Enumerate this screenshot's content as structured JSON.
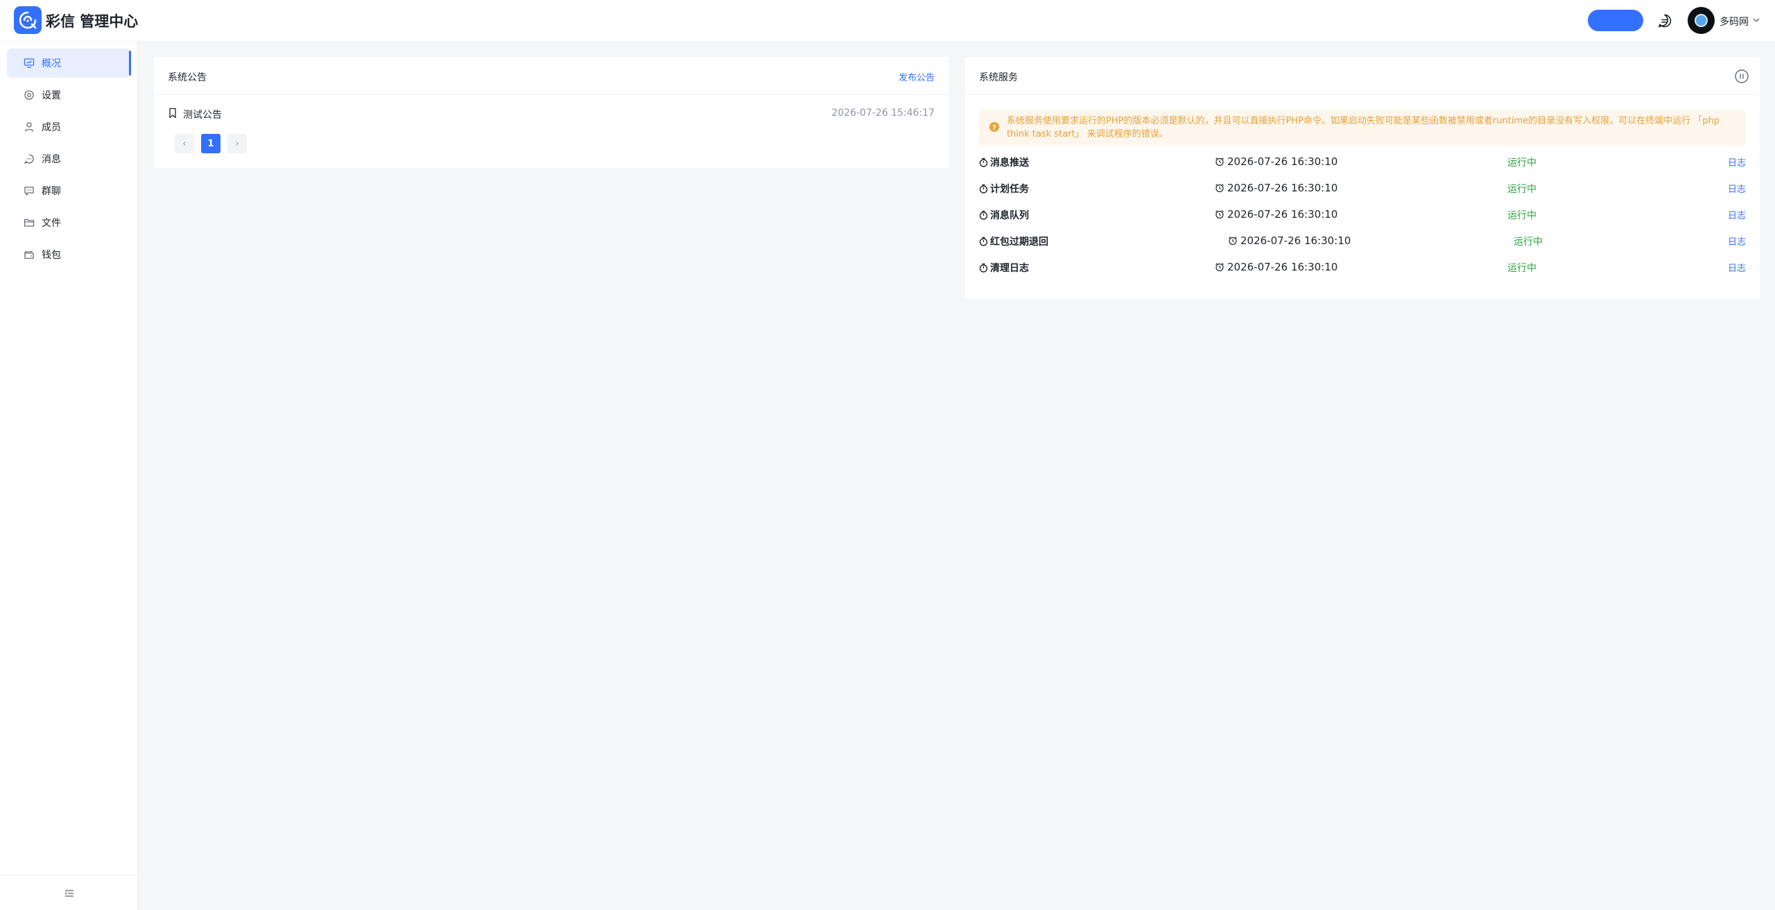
{
  "header": {
    "app_title": "彩信 管理中心",
    "action_button_label": "",
    "user_name": "多码网"
  },
  "sidebar": {
    "items": [
      {
        "label": "概况",
        "icon": "dashboard-icon",
        "active": true
      },
      {
        "label": "设置",
        "icon": "gear-icon"
      },
      {
        "label": "成员",
        "icon": "user-icon"
      },
      {
        "label": "消息",
        "icon": "chat-icon"
      },
      {
        "label": "群聊",
        "icon": "group-chat-icon"
      },
      {
        "label": "文件",
        "icon": "folder-icon"
      },
      {
        "label": "钱包",
        "icon": "wallet-icon"
      }
    ]
  },
  "notice_card": {
    "title": "系统公告",
    "publish_link": "发布公告",
    "items": [
      {
        "title": "测试公告",
        "time": "2026-07-26 15:46:17"
      }
    ],
    "pagination": {
      "prev": "‹",
      "current": "1",
      "next": "›"
    }
  },
  "service_card": {
    "title": "系统服务",
    "alert_text": "系统服务使用要求运行的PHP的版本必须是默认的，并且可以直接执行PHP命令。如果启动失败可能是某些函数被禁用或者runtime的目录没有写入权限，可以在终端中运行 「php think task start」 来调试程序的错误。",
    "services": [
      {
        "name": "消息推送",
        "time": "2026-07-26 16:30:10",
        "status": "运行中",
        "log": "日志"
      },
      {
        "name": "计划任务",
        "time": "2026-07-26 16:30:10",
        "status": "运行中",
        "log": "日志"
      },
      {
        "name": "消息队列",
        "time": "2026-07-26 16:30:10",
        "status": "运行中",
        "log": "日志"
      },
      {
        "name": "红包过期退回",
        "time": "2026-07-26 16:30:10",
        "status": "运行中",
        "log": "日志"
      },
      {
        "name": "清理日志",
        "time": "2026-07-26 16:30:10",
        "status": "运行中",
        "log": "日志"
      }
    ]
  },
  "colors": {
    "accent": "#3370ff",
    "running": "#27a33c",
    "warning": "#e6a23c"
  }
}
